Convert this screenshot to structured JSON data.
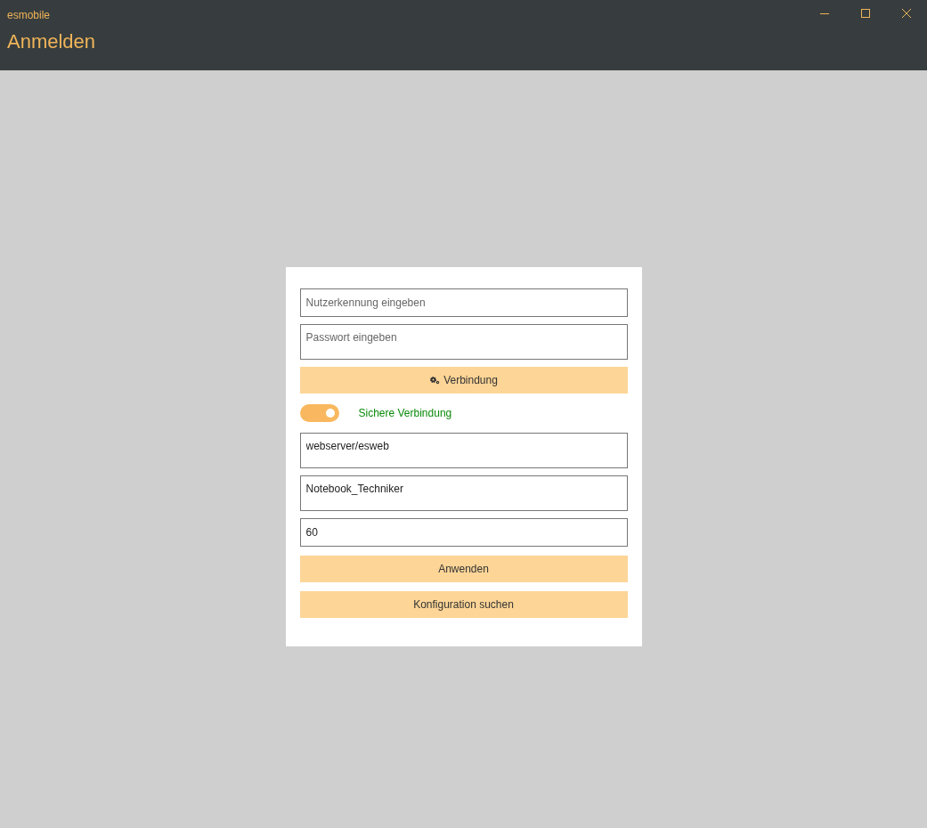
{
  "window": {
    "title": "esmobile"
  },
  "page_title": "Anmelden",
  "form": [
    {
      "kind": "field",
      "placeholder": "Nutzerkennung eingeben"
    },
    {
      "kind": "field",
      "placeholder": "Passwort eingeben"
    },
    {
      "kind": "button",
      "label": "Verbindung"
    },
    {
      "kind": "toggle",
      "label": "Sichere Verbindung",
      "on": true
    },
    {
      "kind": "field",
      "value": "webserver/esweb"
    },
    {
      "kind": "field",
      "value": "Notebook_Techniker"
    },
    {
      "kind": "field",
      "value": "60"
    },
    {
      "kind": "button",
      "label": "Anwenden"
    },
    {
      "kind": "button",
      "label": "Konfiguration suchen"
    }
  ]
}
